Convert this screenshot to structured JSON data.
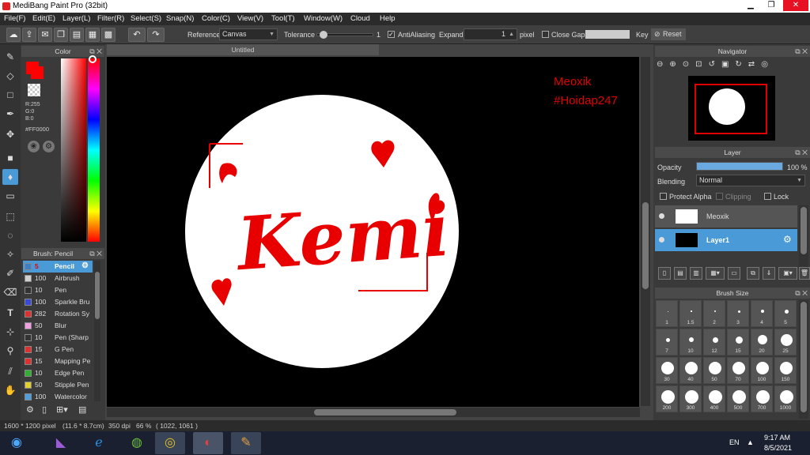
{
  "window": {
    "title": "MediBang Paint Pro (32bit)",
    "min": "▁",
    "max": "❐",
    "close": "✕"
  },
  "menu": [
    "File(F)",
    "Edit(E)",
    "Layer(L)",
    "Filter(R)",
    "Select(S)",
    "Snap(N)",
    "Color(C)",
    "View(V)",
    "Tool(T)",
    "Window(W)",
    "Cloud",
    "Help"
  ],
  "toolbar": {
    "reference_label": "Reference",
    "reference_value": "Canvas",
    "tolerance_label": "Tolerance",
    "tolerance_value": "1",
    "tolerance_level": 0.05,
    "antialiasing_label": "AntiAliasing",
    "antialiasing_checked": true,
    "expand_label": "Expand",
    "expand_value": "1",
    "expand_unit": "pixel",
    "close_gaps_label": "Close Gaps",
    "close_gaps_checked": false,
    "key_label": "Key",
    "reset_label": "Reset"
  },
  "color_panel": {
    "title": "Color",
    "fg_color": "#FF0000",
    "rgb": [
      "R:255",
      "G:0",
      "B:0"
    ],
    "hex": "#FF0000"
  },
  "brush_panel": {
    "title": "Brush: Pencil",
    "items": [
      {
        "size": "5",
        "name": "Pencil",
        "color": "#3d7fc2",
        "selected": true
      },
      {
        "size": "100",
        "name": "Airbrush",
        "color": "#d0d0d0"
      },
      {
        "size": "10",
        "name": "Pen",
        "color": "#333333"
      },
      {
        "size": "100",
        "name": "Sparkle Bru",
        "color": "#3a4ad8"
      },
      {
        "size": "282",
        "name": "Rotation Sy",
        "color": "#e03030"
      },
      {
        "size": "50",
        "name": "Blur",
        "color": "#f0a0e0"
      },
      {
        "size": "10",
        "name": "Pen (Sharp",
        "color": "#333333"
      },
      {
        "size": "15",
        "name": "G Pen",
        "color": "#e03030"
      },
      {
        "size": "15",
        "name": "Mapping Pe",
        "color": "#e03030"
      },
      {
        "size": "10",
        "name": "Edge Pen",
        "color": "#30b030"
      },
      {
        "size": "50",
        "name": "Stipple Pen",
        "color": "#e0d030"
      },
      {
        "size": "100",
        "name": "Watercolor",
        "color": "#50a0e0"
      }
    ]
  },
  "canvas": {
    "tab_title": "Untitled",
    "watermark_line1": "Meoxik",
    "watermark_line2": "#Hoidap247",
    "artwork_text": "Kemi"
  },
  "navigator": {
    "title": "Navigator"
  },
  "layer_panel": {
    "title": "Layer",
    "opacity_label": "Opacity",
    "opacity_value": "100 %",
    "opacity_level": 1.0,
    "blending_label": "Blending",
    "blending_value": "Normal",
    "protect_alpha_label": "Protect Alpha",
    "clipping_label": "Clipping",
    "lock_label": "Lock",
    "layers": [
      {
        "name": "Meoxik",
        "selected": false
      },
      {
        "name": "Layer1",
        "selected": true
      }
    ]
  },
  "brush_size_panel": {
    "title": "Brush Size",
    "sizes": [
      [
        "1",
        "1.5",
        "2",
        "3",
        "4",
        "5"
      ],
      [
        "7",
        "10",
        "12",
        "15",
        "20",
        "25"
      ],
      [
        "30",
        "40",
        "50",
        "70",
        "100",
        "150"
      ],
      [
        "200",
        "300",
        "400",
        "500",
        "700",
        "1000"
      ]
    ]
  },
  "status": {
    "dimensions": "1600 * 1200 pixel",
    "physical": "(11.6 * 8.7cm)",
    "dpi": "350 dpi",
    "zoom": "66 %",
    "cursor": "( 1022, 1061 )"
  },
  "taskbar": {
    "language": "EN",
    "time": "9:17 AM",
    "date": "8/5/2021"
  },
  "colors": {
    "accent": "#4a9ad8",
    "red": "#ff0000"
  }
}
